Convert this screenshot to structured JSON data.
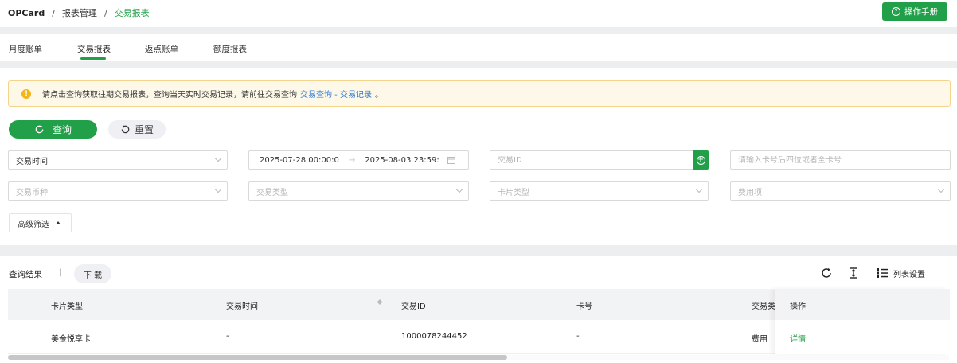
{
  "breadcrumb": {
    "home": "OPCard",
    "sep1": "/",
    "mid": "报表管理",
    "sep2": "/",
    "current": "交易报表"
  },
  "header": {
    "manual_label": "操作手册"
  },
  "tabs": [
    {
      "label": "月度账单"
    },
    {
      "label": "交易报表"
    },
    {
      "label": "返点账单"
    },
    {
      "label": "额度报表"
    }
  ],
  "alert": {
    "text": "请点击查询获取往期交易报表，查询当天实时交易记录，请前往交易查询",
    "link": "交易查询 - 交易记录",
    "suffix": "。"
  },
  "actions": {
    "query_label": "查询",
    "reset_label": "重置"
  },
  "filters": {
    "time_type": "交易时间",
    "date_start": "2025-07-28 00:00:0",
    "date_arrow": "→",
    "date_end": "2025-08-03 23:59:",
    "txn_id_placeholder": "交易ID",
    "card_placeholder": "请输入卡号后四位或者全卡号",
    "currency_placeholder": "交易币种",
    "txn_type_placeholder": "交易类型",
    "card_type_placeholder": "卡片类型",
    "fee_placeholder": "费用项",
    "advanced_label": "高级筛选"
  },
  "results": {
    "label": "查询结果",
    "sep": "|",
    "download_label": "下 载",
    "column_settings_label": "列表设置"
  },
  "table": {
    "columns": [
      "卡片类型",
      "交易时间",
      "交易ID",
      "卡号",
      "交易类",
      "操作"
    ],
    "rows": [
      {
        "card_type": "美金悦享卡",
        "time": "-",
        "txn_id": "1000078244452",
        "card_no": "-",
        "txn_type": "费用",
        "action": "详情"
      }
    ]
  },
  "colors": {
    "accent": "#22a049",
    "link": "#2b77d0",
    "warning": "#f2b51d"
  }
}
